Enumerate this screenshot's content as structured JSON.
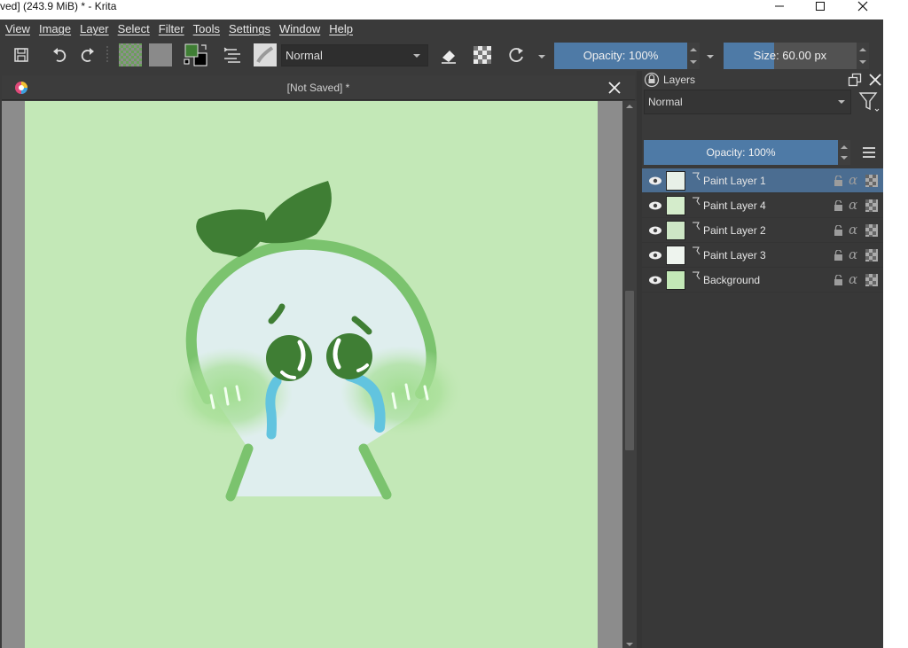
{
  "window": {
    "title": "ved]  (243.9 MiB)  * - Krita"
  },
  "menubar": {
    "items": [
      "View",
      "Image",
      "Layer",
      "Select",
      "Filter",
      "Tools",
      "Settings",
      "Window",
      "Help"
    ]
  },
  "toolbar": {
    "blend_mode": "Normal",
    "opacity_label": "Opacity: 100%",
    "opacity_value": 1.0,
    "size_label": "Size: 60.00 px",
    "size_fill_fraction": 0.38
  },
  "document": {
    "tab_title": "[Not Saved]  *"
  },
  "colors": {
    "app_bg": "#3a3a3a",
    "accent": "#4e7aa6",
    "selected_row": "#4b6d91",
    "canvas_bg": "#c3e8b7",
    "leaf": "#3f7e34",
    "body_outline": "#7bc36e",
    "body_fill": "#dfeeee",
    "tears": "#62c4df"
  },
  "layers_docker": {
    "title": "Layers",
    "blend_mode": "Normal",
    "opacity_label": "Opacity:  100%",
    "layers": [
      {
        "name": "Paint Layer 1",
        "selected": true
      },
      {
        "name": "Paint Layer 4",
        "selected": false
      },
      {
        "name": "Paint Layer 2",
        "selected": false
      },
      {
        "name": "Paint Layer 3",
        "selected": false
      },
      {
        "name": "Background",
        "selected": false
      }
    ]
  }
}
